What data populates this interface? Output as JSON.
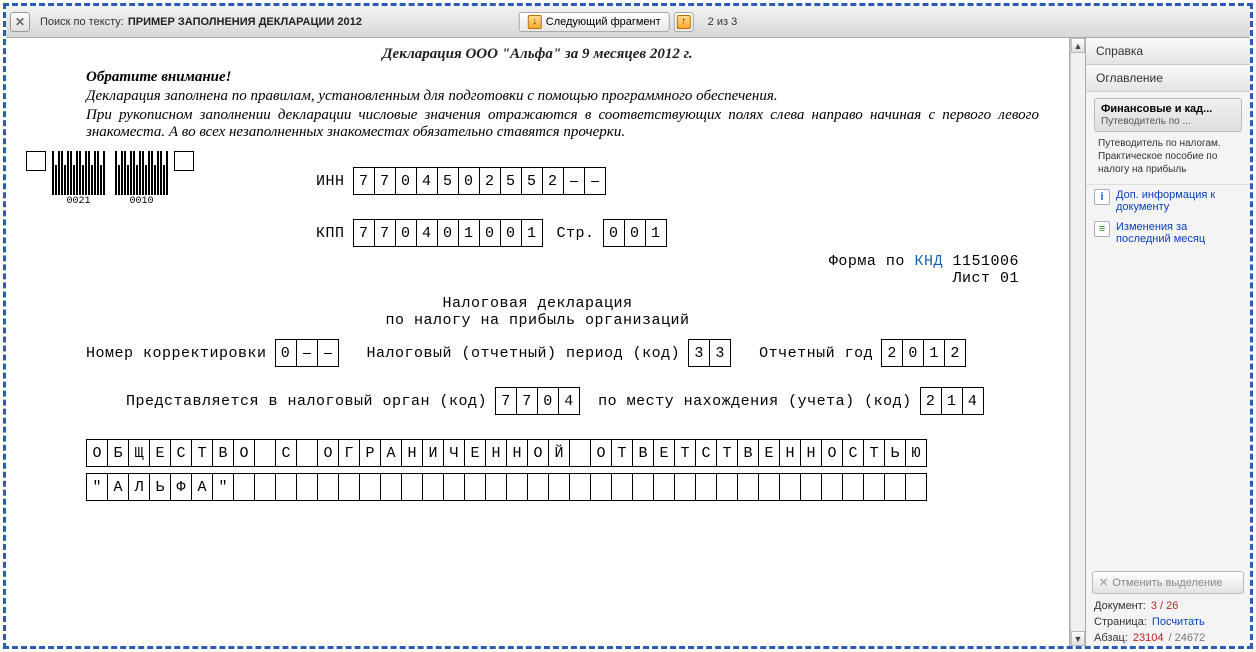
{
  "topbar": {
    "search_label": "Поиск по тексту:",
    "search_term": "ПРИМЕР ЗАПОЛНЕНИЯ ДЕКЛАРАЦИИ 2012",
    "next_fragment": "Следующий фрагмент",
    "counter": "2 из 3"
  },
  "sidebar": {
    "help": "Справка",
    "toc": "Оглавление",
    "card_title": "Финансовые и кад...",
    "card_sub": "Путеводитель по ...",
    "card_text": "Путеводитель по налогам. Практическое пособие по налогу на прибыль",
    "extra_info": "Доп. информация к документу",
    "changes": "Изменения за последний месяц",
    "cancel_sel": "Отменить выделение",
    "doc_label": "Документ:",
    "doc_val": "3 / 26",
    "page_label": "Страница:",
    "page_link": "Посчитать",
    "par_label": "Абзац:",
    "par_cur": "23104",
    "par_tot": "24672"
  },
  "doc": {
    "title": "Декларация ООО \"Альфа\" за 9 месяцев 2012 г.",
    "note1": "Обратите внимание!",
    "note2": "Декларация заполнена по правилам, установленным для подготовки с помощью программного обеспечения.",
    "note3": "При рукописном заполнении декларации числовые значения отражаются в соответствующих полях слева направо начиная с первого левого знакоместа. А во всех незаполненных знакоместах обязательно ставятся прочерки.",
    "barcode_labels": [
      "0021",
      "0010"
    ],
    "inn_label": "ИНН",
    "inn": [
      "7",
      "7",
      "0",
      "4",
      "5",
      "0",
      "2",
      "5",
      "5",
      "2",
      "-",
      "-"
    ],
    "kpp_label": "КПП",
    "kpp": [
      "7",
      "7",
      "0",
      "4",
      "0",
      "1",
      "0",
      "0",
      "1"
    ],
    "page_label": "Стр.",
    "page": [
      "0",
      "0",
      "1"
    ],
    "form_label": "Форма по",
    "knd_label": "КНД",
    "knd": "1151006",
    "sheet": "Лист 01",
    "main_title_1": "Налоговая декларация",
    "main_title_2": "по налогу на прибыль организаций",
    "corr_label": "Номер корректировки",
    "corr": [
      "0",
      "-",
      "-"
    ],
    "period_label": "Налоговый (отчетный) период (код)",
    "period": [
      "3",
      "3"
    ],
    "year_label": "Отчетный год",
    "year": [
      "2",
      "0",
      "1",
      "2"
    ],
    "organ_label": "Представляется в налоговый орган (код)",
    "organ": [
      "7",
      "7",
      "0",
      "4"
    ],
    "place_label": "по месту нахождения (учета) (код)",
    "place": [
      "2",
      "1",
      "4"
    ],
    "org_name_1": [
      "О",
      "Б",
      "Щ",
      "Е",
      "С",
      "Т",
      "В",
      "О",
      "",
      "С",
      "",
      "О",
      "Г",
      "Р",
      "А",
      "Н",
      "И",
      "Ч",
      "Е",
      "Н",
      "Н",
      "О",
      "Й",
      "",
      "О",
      "Т",
      "В",
      "Е",
      "Т",
      "С",
      "Т",
      "В",
      "Е",
      "Н",
      "Н",
      "О",
      "С",
      "Т",
      "Ь",
      "Ю"
    ],
    "org_name_2": [
      "\"",
      "А",
      "Л",
      "Ь",
      "Ф",
      "А",
      "\"",
      "",
      "",
      "",
      "",
      "",
      "",
      "",
      "",
      "",
      "",
      "",
      "",
      "",
      "",
      "",
      "",
      "",
      "",
      "",
      "",
      "",
      "",
      "",
      "",
      "",
      "",
      "",
      "",
      "",
      "",
      "",
      "",
      ""
    ]
  }
}
